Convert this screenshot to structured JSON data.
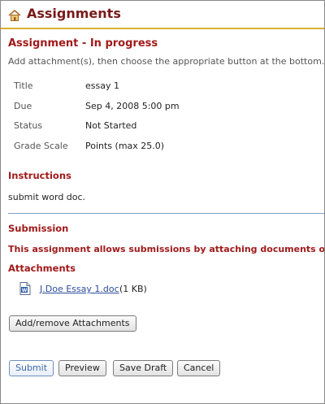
{
  "header": {
    "title": "Assignments"
  },
  "assignment": {
    "heading": "Assignment - In progress",
    "instruction_line": "Add attachment(s), then choose the appropriate button at the bottom."
  },
  "details": [
    {
      "label": "Title",
      "value": "essay 1"
    },
    {
      "label": "Due",
      "value": "Sep 4, 2008 5:00 pm"
    },
    {
      "label": "Status",
      "value": "Not Started"
    },
    {
      "label": "Grade Scale",
      "value": "Points (max 25.0)"
    }
  ],
  "instructions": {
    "heading": "Instructions",
    "text": "submit word doc."
  },
  "submission": {
    "heading": "Submission",
    "notice": "This assignment allows submissions by attaching documents only.",
    "attachments_heading": "Attachments",
    "attachment": {
      "name": "J.Doe Essay 1.doc",
      "size": "(1 KB)"
    },
    "add_remove_label": "Add/remove Attachments"
  },
  "actions": {
    "submit": "Submit",
    "preview": "Preview",
    "save_draft": "Save Draft",
    "cancel": "Cancel"
  },
  "colors": {
    "title": "#7a1a1a",
    "heading_red": "#a11a1a",
    "header_rule": "#d9b130",
    "divider_blue": "#7fa2cc",
    "link_blue": "#2c4c9c"
  },
  "icons": {
    "header": "home-icon",
    "attachment": "word-document-icon"
  }
}
